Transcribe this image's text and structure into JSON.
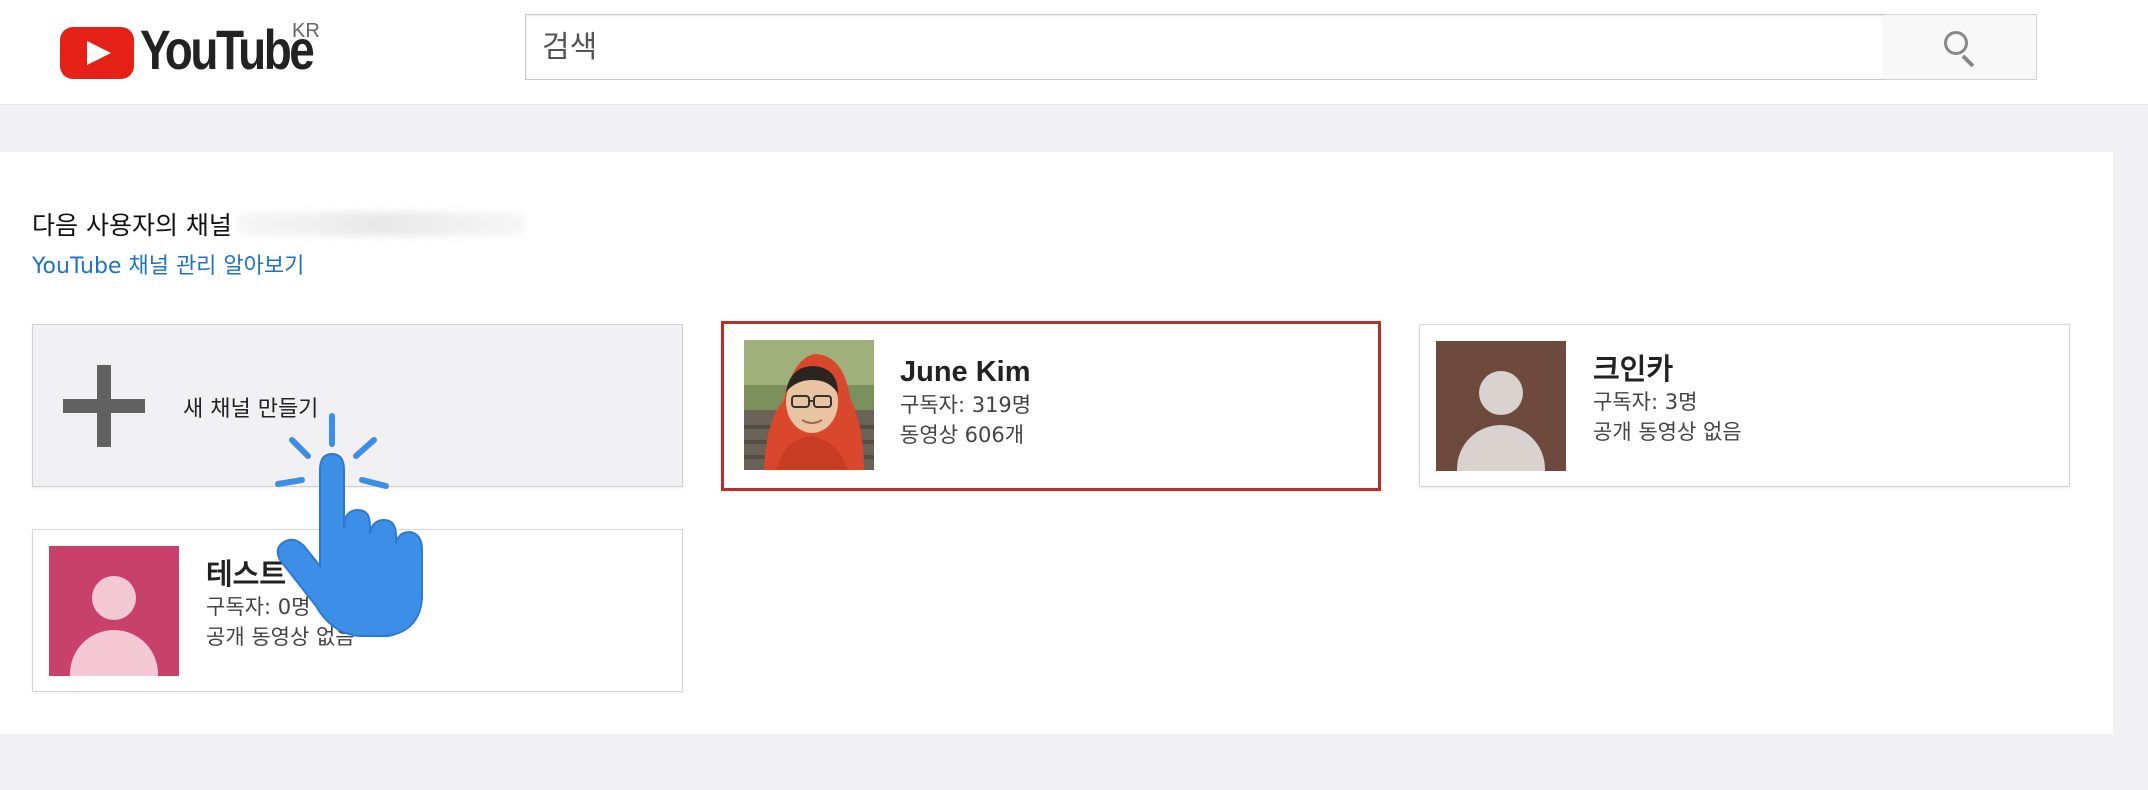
{
  "header": {
    "logo_text": "YouTube",
    "logo_region": "KR",
    "search_placeholder": "검색",
    "search_value": ""
  },
  "panel": {
    "owner_prefix": "다음 사용자의 채널",
    "learn_link": "YouTube 채널 관리 알아보기"
  },
  "create_card": {
    "label": "새 채널 만들기"
  },
  "channels": [
    {
      "name": "June Kim",
      "subscribers": "구독자: 319명",
      "videos": "동영상 606개",
      "selected": true
    },
    {
      "name": "크인카",
      "subscribers": "구독자: 3명",
      "videos": "공개 동영상 없음",
      "avatar_color": "#6d4a3d"
    },
    {
      "name": "테스트",
      "subscribers": "구독자: 0명",
      "videos": "공개 동영상 없음",
      "avatar_color": "#c7416b"
    }
  ],
  "colors": {
    "brand_red": "#e62117",
    "link_blue": "#1e73c8",
    "selected_border": "#b5302a",
    "cursor_blue": "#3d8ee6"
  },
  "icons": {
    "search": "search-icon",
    "plus": "plus-icon",
    "cursor": "hand-pointer-icon"
  }
}
